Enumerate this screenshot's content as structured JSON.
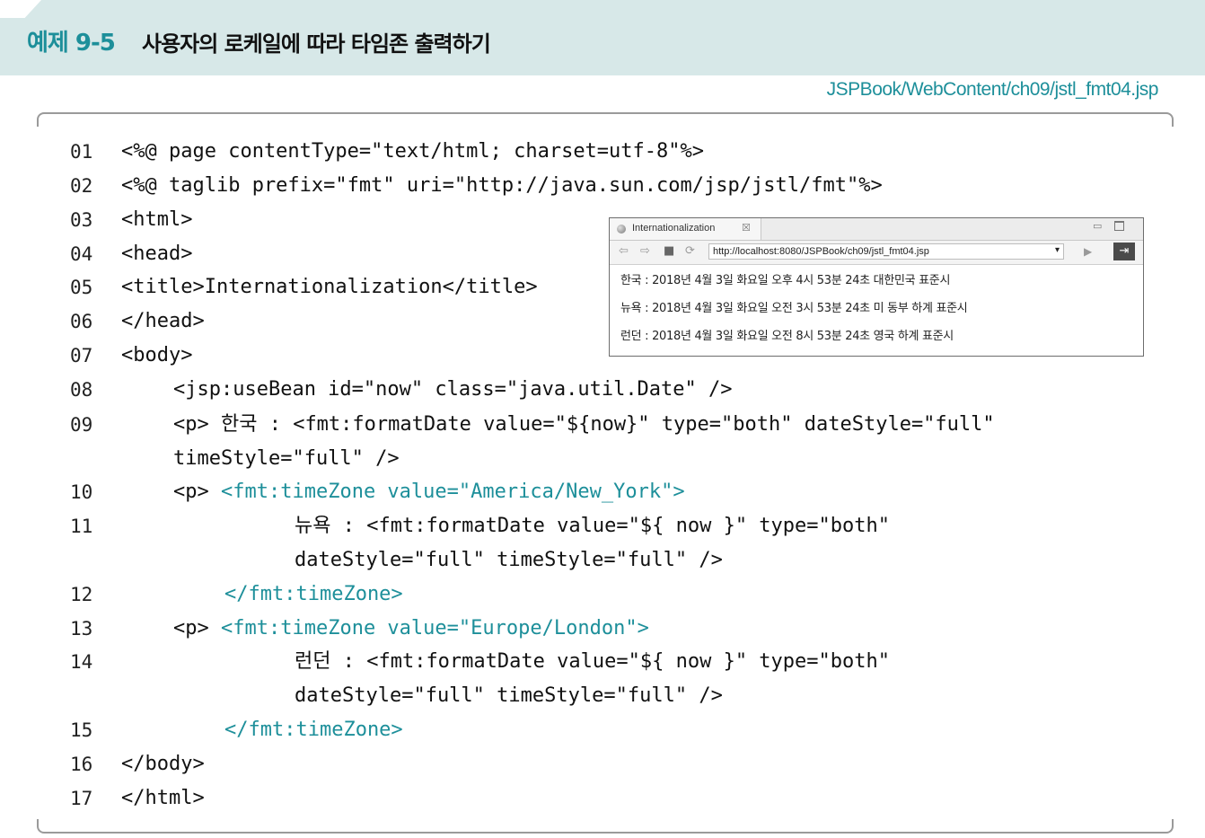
{
  "header": {
    "example_label": "예제 9-5",
    "title": "사용자의 로케일에 따라 타임존 출력하기",
    "file_path": "JSPBook/WebContent/ch09/jstl_fmt04.jsp",
    "accent_color": "#1d8f9a"
  },
  "code": {
    "lines": [
      {
        "no": "01",
        "text": "<%@ page contentType=\"text/html; charset=utf-8\"%>"
      },
      {
        "no": "02",
        "text": "<%@ taglib prefix=\"fmt\" uri=\"http://java.sun.com/jsp/jstl/fmt\"%>"
      },
      {
        "no": "03",
        "text": "<html>"
      },
      {
        "no": "04",
        "text": "<head>"
      },
      {
        "no": "05",
        "text": "<title>Internationalization</title>"
      },
      {
        "no": "06",
        "text": "</head>"
      },
      {
        "no": "07",
        "text": "<body>"
      },
      {
        "no": "08",
        "text": "<jsp:useBean id=\"now\" class=\"java.util.Date\" />"
      },
      {
        "no": "09",
        "text": "<p> 한국 : <fmt:formatDate value=\"${now}\" type=\"both\" dateStyle=\"full\"",
        "cont": "timeStyle=\"full\" />"
      },
      {
        "no": "10",
        "text_a": "<p> ",
        "text_b": "<fmt:timeZone value=\"America/New_York\">"
      },
      {
        "no": "11",
        "text": "뉴욕 : <fmt:formatDate value=\"${ now }\" type=\"both\"",
        "cont": "dateStyle=\"full\" timeStyle=\"full\" />"
      },
      {
        "no": "12",
        "text": "</fmt:timeZone>"
      },
      {
        "no": "13",
        "text_a": "<p> ",
        "text_b": "<fmt:timeZone value=\"Europe/London\">"
      },
      {
        "no": "14",
        "text": "런던 : <fmt:formatDate value=\"${ now }\" type=\"both\"",
        "cont": "dateStyle=\"full\" timeStyle=\"full\" />"
      },
      {
        "no": "15",
        "text": "</fmt:timeZone>"
      },
      {
        "no": "16",
        "text": "</body>"
      },
      {
        "no": "17",
        "text": "</html>"
      }
    ]
  },
  "browser": {
    "tab_title": "Internationalization",
    "tab_close": "☒",
    "url": "http://localhost:8080/JSPBook/ch09/jstl_fmt04.jsp",
    "output": [
      "한국 : 2018년 4월 3일 화요일 오후 4시 53분 24초 대한민국 표준시",
      "뉴욕 : 2018년 4월 3일 화요일 오전 3시 53분 24초 미 동부 하계 표준시",
      "런던 : 2018년 4월 3일 화요일 오전 8시 53분 24초 영국 하계 표준시"
    ]
  }
}
